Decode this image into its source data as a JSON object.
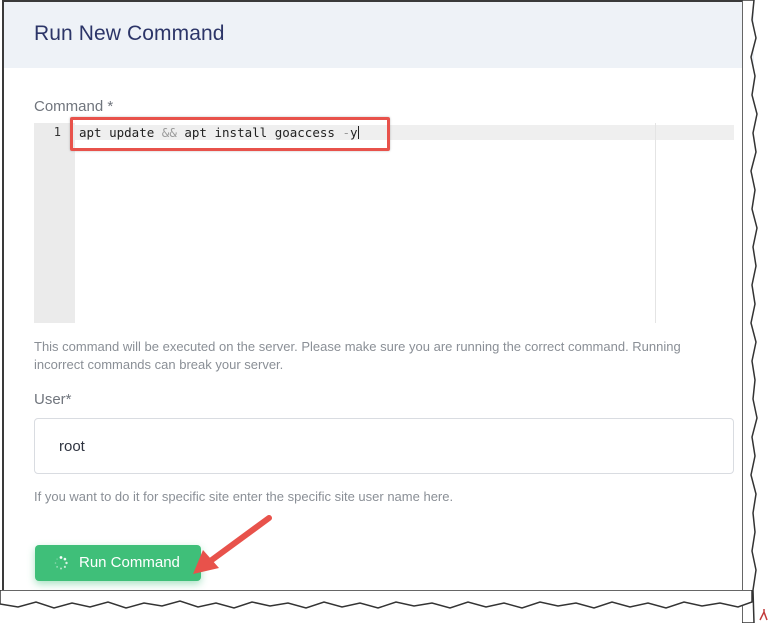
{
  "header": {
    "title": "Run New Command"
  },
  "command": {
    "label": "Command *",
    "line_number": "1",
    "code_parts": [
      "apt update ",
      "&&",
      " apt install goaccess ",
      "-",
      "y"
    ],
    "help": "This command will be executed on the server. Please make sure you are running the correct command. Running incorrect commands can break your server."
  },
  "user": {
    "label": "User*",
    "value": "root",
    "help": "If you want to do it for specific site enter the specific site user name here."
  },
  "button": {
    "label": "Run Command",
    "spinner_icon": "spinner-icon"
  },
  "annotations": {
    "highlight_color": "#e8524b",
    "arrow_color": "#e8524b"
  },
  "colors": {
    "header_bg": "#eef2f7",
    "title": "#2c3568",
    "button": "#3fbf79"
  }
}
